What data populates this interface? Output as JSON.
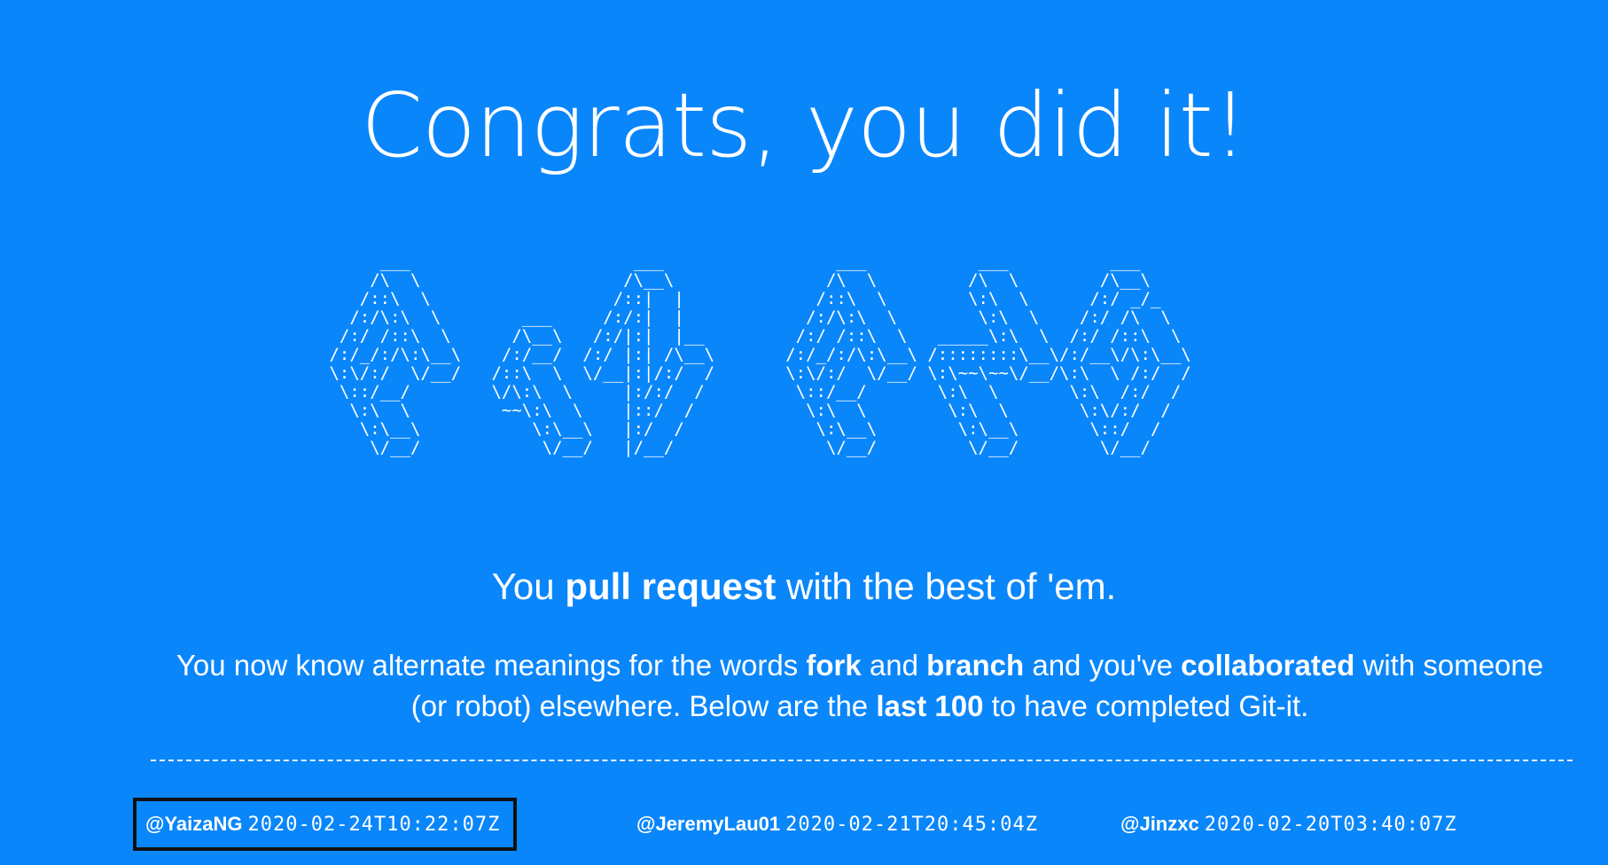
{
  "headline": "Congrats, you did it!",
  "ascii_art": "      ___                      ___                 ___           ___          ___\n     /\\  \\                    /\\__\\               /\\  \\         /\\  \\        /\\__\\\n    /::\\  \\                  /::|  |             /::\\  \\        \\:\\  \\      /:/ _/_\n   /:/\\:\\  \\        ___     /:/:|  |            /:/\\:\\  \\        \\:\\  \\    /:/ /\\  \\\n  /:/ /::\\  \\      /\\__\\   /:/|:|  |__         /:/ /::\\  \\   _____\\:\\  \\  /:/ /::\\  \\\n /:/_/:/\\:\\__\\    /:/__/  /:/ |:| /\\__\\       /:/_/:/\\:\\__\\ /::::::::\\__\\/:/__\\/\\:\\__\\\n \\:\\/:/  \\/__/   /::\\  \\  \\/__|:|/:/  /       \\:\\/:/  \\/__/ \\:\\~~\\~~\\/__/\\:\\  \\ /:/  /\n  \\::/__/        \\/\\:\\  \\     |:/:/  /         \\::/__/       \\:\\  \\       \\:\\  /:/  /\n   \\:\\  \\         ~~\\:\\  \\    |::/  /           \\:\\  \\        \\:\\  \\       \\:\\/:/  /\n    \\:\\__\\           \\:\\__\\   |:/  /             \\:\\__\\        \\:\\__\\       \\::/  /\n     \\/__/            \\/__/   |/__/               \\/__/         \\/__/        \\/__/",
  "tagline": {
    "pre": "You ",
    "bold": "pull request",
    "post": " with the best of 'em."
  },
  "intro": {
    "p1": "You now know alternate meanings for the words ",
    "b1": "fork",
    "p2": " and ",
    "b2": "branch",
    "p3": " and you've ",
    "b3": "collaborated",
    "p4": " with someone (or robot) elsewhere. Below are the ",
    "b4": "last 100",
    "p5": " to have completed Git-it."
  },
  "completers": [
    {
      "handle": "@YaizaNG",
      "timestamp": "2020-02-24T10:22:07Z",
      "highlighted": true
    },
    {
      "handle": "@JeremyLau01",
      "timestamp": "2020-02-21T20:45:04Z",
      "highlighted": false
    },
    {
      "handle": "@Jinzxc",
      "timestamp": "2020-02-20T03:40:07Z",
      "highlighted": false
    }
  ],
  "colors": {
    "background": "#0a86fb",
    "text": "#ffffff",
    "highlight_border": "#111111"
  }
}
